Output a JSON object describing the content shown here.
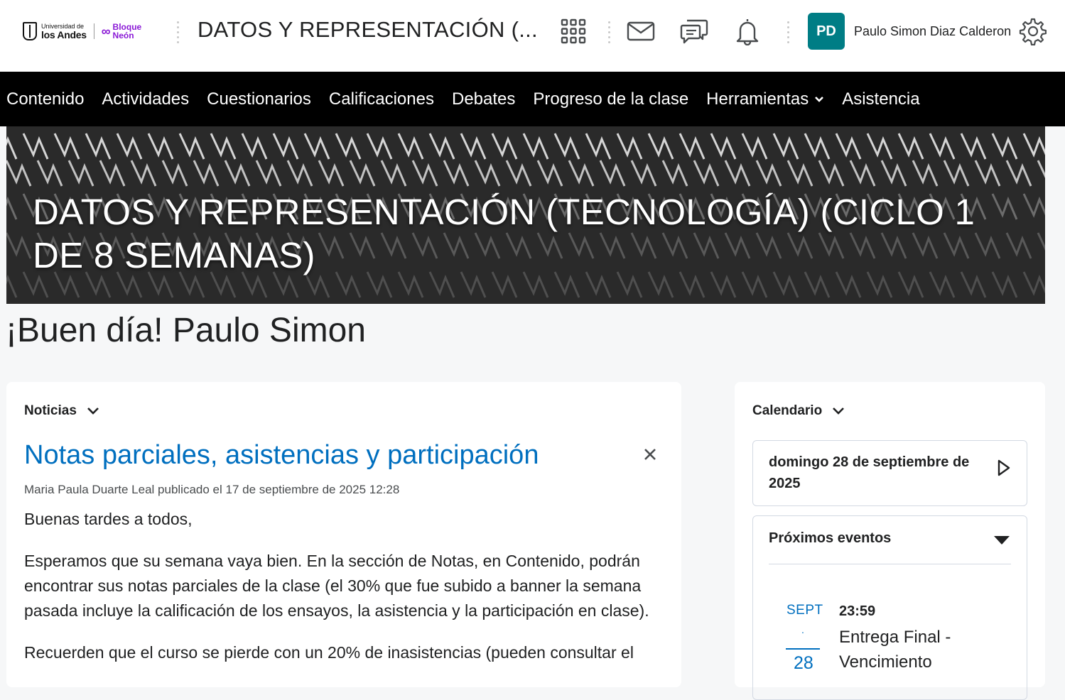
{
  "header": {
    "logo": {
      "university_small": "Universidad de",
      "university_big": "los Andes",
      "neon_line1": "Bloque",
      "neon_line2": "Neón"
    },
    "course_title": "DATOS Y REPRESENTACIÓN (...",
    "icons": [
      "waffle-icon",
      "mail-icon",
      "chat-icon",
      "bell-icon",
      "gear-icon"
    ],
    "user_initials": "PD",
    "user_name": "Paulo Simon Diaz Calderon",
    "avatar_color": "#007d85"
  },
  "nav": {
    "items": [
      "Contenido",
      "Actividades",
      "Cuestionarios",
      "Calificaciones",
      "Debates",
      "Progreso de la clase",
      "Herramientas",
      "Asistencia"
    ]
  },
  "banner": {
    "title": "DATOS Y REPRESENTACIÓN (TECNOLOGÍA) (CICLO 1 DE 8 SEMANAS)"
  },
  "greeting": "¡Buen día! Paulo Simon",
  "news": {
    "heading": "Noticias",
    "title": "Notas parciales, asistencias y participación",
    "meta": "Maria Paula Duarte Leal publicado el 17 de septiembre de 2025 12:28",
    "paragraphs": [
      "Buenas tardes a todos,",
      "Esperamos que su semana vaya bien. En la sección de Notas, en Contenido, podrán encontrar sus notas parciales de la clase (el 30% que fue subido a banner la semana pasada incluye la calificación de los ensayos, la asistencia y la participación en clase).",
      "Recuerden que el curso se pierde con un 20% de inasistencias (pueden consultar el"
    ],
    "link_color": "#006fbf"
  },
  "calendar": {
    "heading": "Calendario",
    "date": "domingo 28 de septiembre de 2025",
    "upcoming_heading": "Próximos eventos",
    "event": {
      "month": "SEPT",
      "dot": ".",
      "day": "28",
      "time": "23:59",
      "title": "Entrega Final - Vencimiento"
    }
  }
}
